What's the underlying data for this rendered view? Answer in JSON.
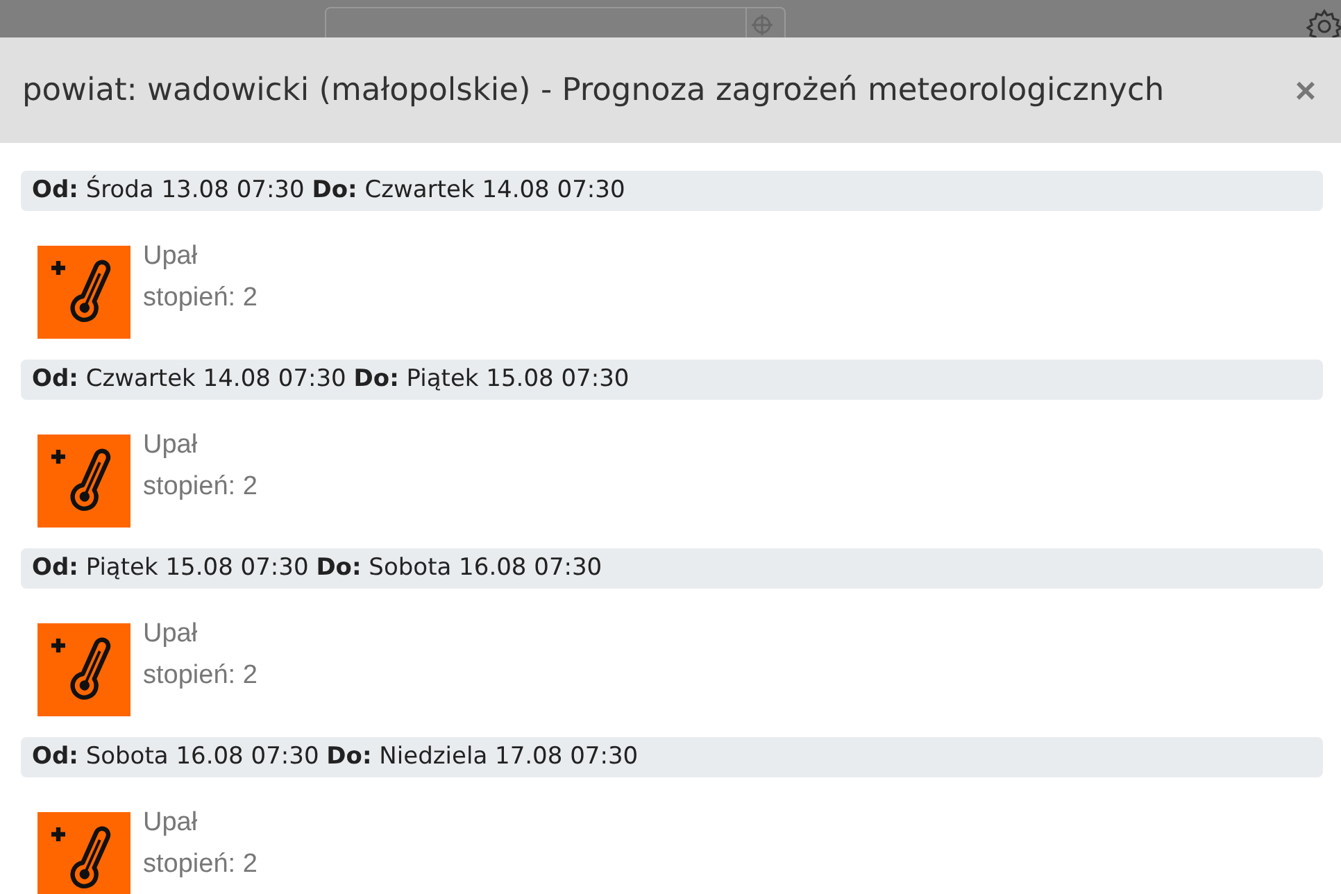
{
  "dialog": {
    "title": "powiat: wadowicki (małopolskie) - Prognoza zagrożeń meteorologicznych",
    "close": "×"
  },
  "periods": [
    {
      "heading": "**Od:** Środa 13.08 07:30 **Do:** Czwartek 14.08 07:30",
      "warnings": [
        {
          "kind": "heat",
          "name": "Upał",
          "degree": "stopień: 2"
        }
      ]
    },
    {
      "heading": "**Od:** Czwartek 14.08 07:30 **Do:** Piątek 15.08 07:30",
      "warnings": [
        {
          "kind": "heat",
          "name": "Upał",
          "degree": "stopień: 2"
        }
      ]
    },
    {
      "heading": "**Od:** Piątek 15.08 07:30 **Do:** Sobota 16.08 07:30",
      "warnings": [
        {
          "kind": "heat",
          "name": "Upał",
          "degree": "stopień: 2"
        }
      ]
    },
    {
      "heading": "**Od:** Sobota 16.08 07:30 **Do:** Niedziela 17.08 07:30",
      "warnings": [
        {
          "kind": "heat",
          "name": "Upał",
          "degree": "stopień: 2"
        }
      ]
    }
  ]
}
